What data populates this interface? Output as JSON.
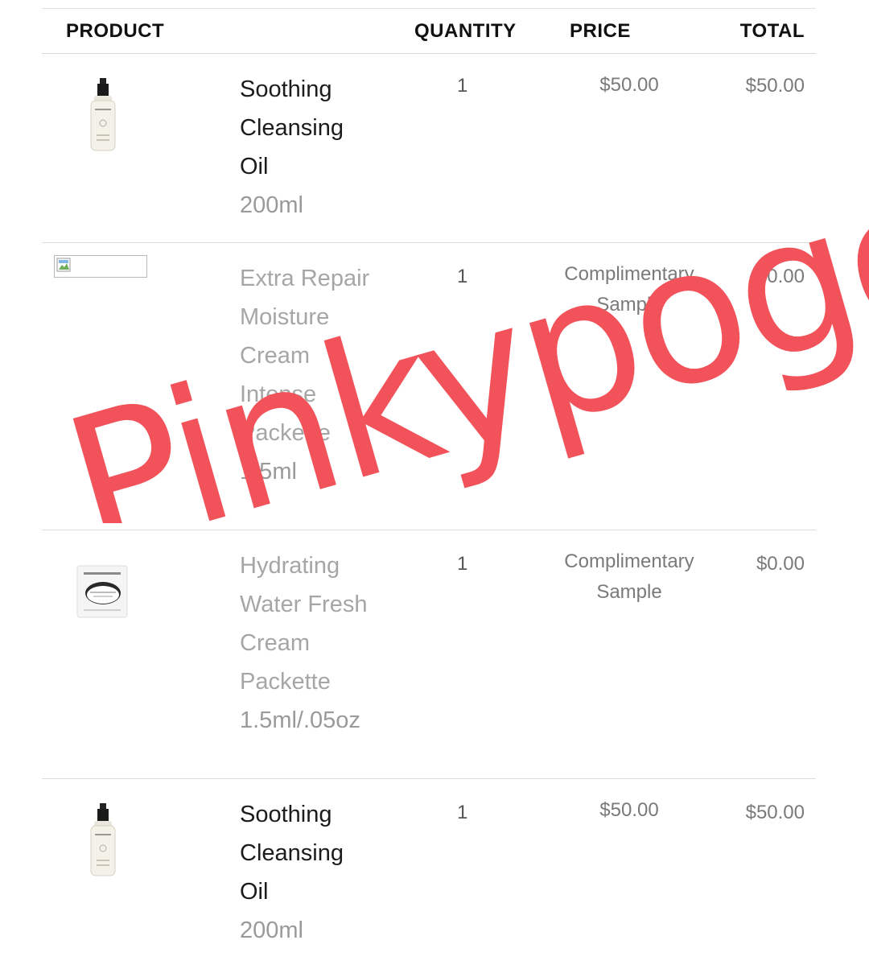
{
  "header": {
    "product_label": "PRODUCT",
    "quantity_label": "QUANTITY",
    "price_label": "PRICE",
    "total_label": "TOTAL"
  },
  "items": [
    {
      "title_lines": [
        "Soothing",
        "Cleansing",
        "Oil"
      ],
      "size": "200ml",
      "quantity": "1",
      "price_lines": [
        "$50.00"
      ],
      "total": "$50.00",
      "image": "cleansing-oil-bottle"
    },
    {
      "title_lines": [
        "Extra Repair",
        "Moisture",
        "Cream",
        "Intense",
        "Packette"
      ],
      "size": "1.5ml",
      "quantity": "1",
      "price_lines": [
        "Complimentary",
        "Sample"
      ],
      "total": "$0.00",
      "image": "broken-image"
    },
    {
      "title_lines": [
        "Hydrating",
        "Water Fresh",
        "Cream",
        "Packette"
      ],
      "size": "1.5ml/.05oz",
      "quantity": "1",
      "price_lines": [
        "Complimentary",
        "Sample"
      ],
      "total": "$0.00",
      "image": "cream-packette"
    },
    {
      "title_lines": [
        "Soothing",
        "Cleansing",
        "Oil"
      ],
      "size": "200ml",
      "quantity": "1",
      "price_lines": [
        "$50.00"
      ],
      "total": "$50.00",
      "image": "cleansing-oil-bottle"
    }
  ],
  "watermark": {
    "text": "Pinkypogo",
    "color": "#f2525a"
  },
  "colors": {
    "header_text": "#111111",
    "product_text": "#1c1c1c",
    "sample_text": "#a6a6a6",
    "price_text": "#7a7a7a",
    "divider": "#dcdcdc"
  }
}
